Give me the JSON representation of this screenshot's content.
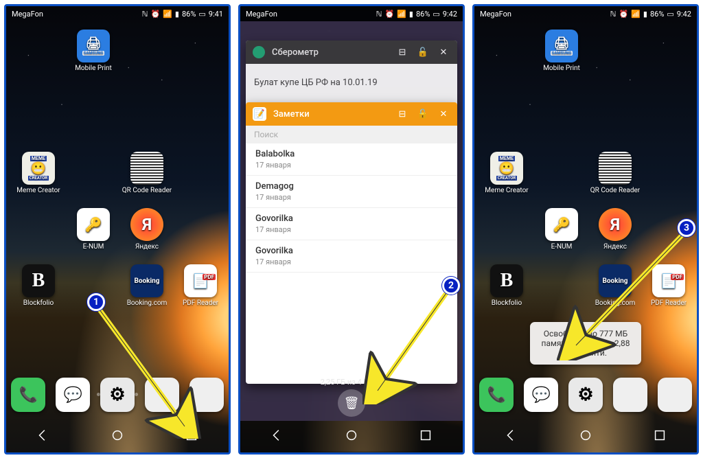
{
  "status": {
    "carrier": "MegaFon",
    "battery": "86%",
    "time1": "9:41",
    "time2": "9:42"
  },
  "apps": {
    "mobile_print": "Mobile Print",
    "samsung": "SAMSUNG",
    "printer_glyph": "🖨",
    "meme": "Meme Creator",
    "meme_tag": "MEME",
    "meme_sub": "CREATOR",
    "qr": "QR Code Reader",
    "enum": "E-NUM",
    "yandex": "Яндекс",
    "yandex_letter": "Я",
    "block": "Blockfolio",
    "block_letter": "B",
    "booking": "Booking.com",
    "booking_word": "Booking",
    "pdf": "PDF Reader",
    "pdf_badge": "PDF"
  },
  "dock": {
    "phone": "📞",
    "msg": "💬",
    "settings": "⚙"
  },
  "recents": {
    "card1": {
      "title": "Сберометр",
      "body": "Булат купе ЦБ РФ на 10.01.19"
    },
    "card2": {
      "title": "Заметки",
      "search": "Поиск",
      "notes": [
        {
          "t": "Balabolka",
          "d": "17 января"
        },
        {
          "t": "Demagog",
          "d": "17 января"
        },
        {
          "t": "Govorilka",
          "d": "17 января"
        },
        {
          "t": "Govorilka",
          "d": "17 января"
        }
      ]
    },
    "mem": "2,25 ГБ из 4 ГБ св"
  },
  "toast": "Освобождено 777 МБ памяти. Свободно 2,88 ГБ памяти.",
  "markers": {
    "m1": "1",
    "m2": "2",
    "m3": "3"
  },
  "glyphs": {
    "split": "⊟",
    "lock": "🔓",
    "close": "✕",
    "trash": "🗑",
    "note": "📝"
  }
}
